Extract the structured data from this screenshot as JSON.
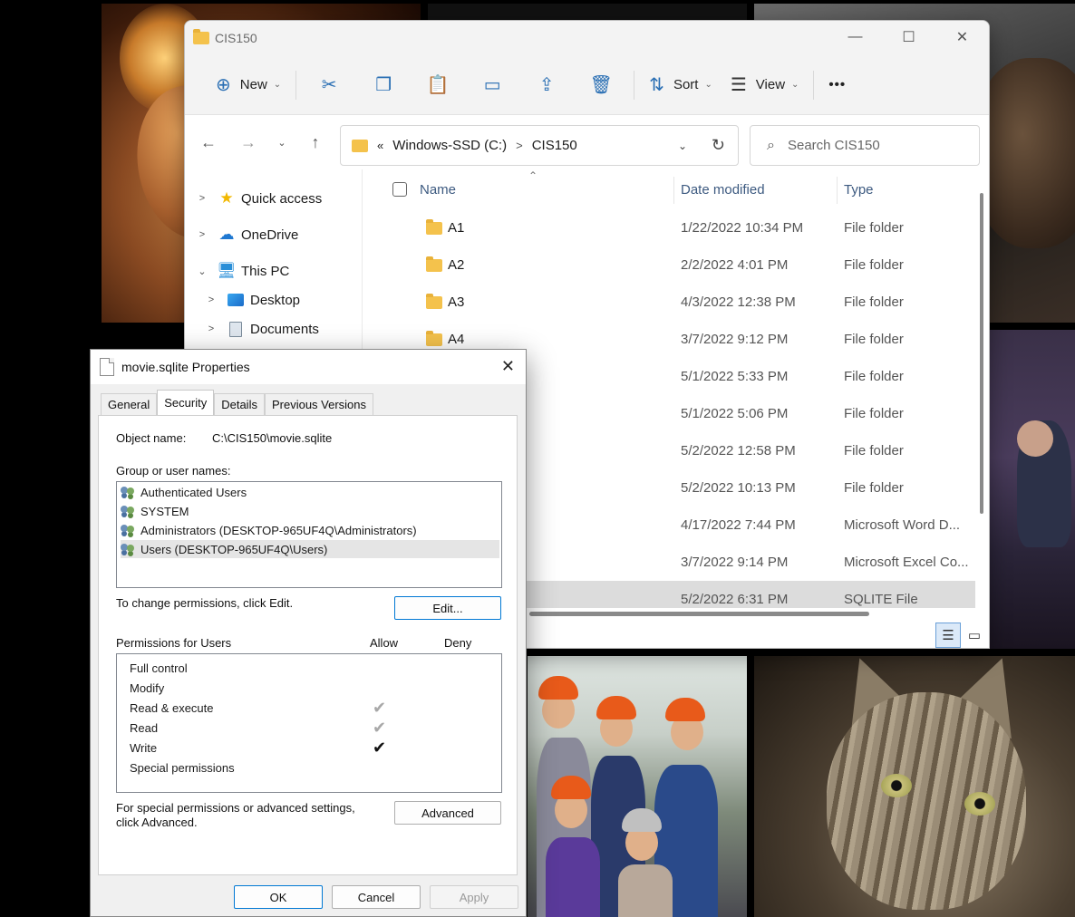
{
  "explorer": {
    "title": "CIS150",
    "caption": {
      "minimize": "—",
      "maximize": "☐",
      "close": "✕"
    },
    "toolbar": {
      "new_label": "New",
      "sort_label": "Sort",
      "view_label": "View",
      "more_label": "•••",
      "icons": [
        "cut-icon",
        "copy-icon",
        "paste-icon",
        "rename-icon",
        "share-icon",
        "delete-icon"
      ]
    },
    "address": {
      "overflow": "«",
      "crumbs": [
        "Windows-SSD (C:)",
        "CIS150"
      ],
      "search_placeholder": "Search CIS150"
    },
    "nav": [
      {
        "label": "Quick access",
        "expanded": false,
        "icon": "star-icon"
      },
      {
        "label": "OneDrive",
        "expanded": false,
        "icon": "cloud-icon"
      },
      {
        "label": "This PC",
        "expanded": true,
        "icon": "monitor-icon"
      },
      {
        "label": "Desktop",
        "expanded": false,
        "icon": "desktop-icon"
      },
      {
        "label": "Documents",
        "expanded": false,
        "icon": "documents-icon"
      }
    ],
    "columns": {
      "name": "Name",
      "date": "Date modified",
      "type": "Type"
    },
    "files": [
      {
        "name": "A1",
        "date": "1/22/2022 10:34 PM",
        "type": "File folder"
      },
      {
        "name": "A2",
        "date": "2/2/2022 4:01 PM",
        "type": "File folder"
      },
      {
        "name": "A3",
        "date": "4/3/2022 12:38 PM",
        "type": "File folder"
      },
      {
        "name": "A4",
        "date": "3/7/2022 9:12 PM",
        "type": "File folder"
      },
      {
        "name": "",
        "date": "5/1/2022 5:33 PM",
        "type": "File folder"
      },
      {
        "name": "",
        "date": "5/1/2022 5:06 PM",
        "type": "File folder"
      },
      {
        "name": "",
        "date": "5/2/2022 12:58 PM",
        "type": "File folder"
      },
      {
        "name": "",
        "date": "5/2/2022 10:13 PM",
        "type": "File folder"
      },
      {
        "name": "",
        "date": "4/17/2022 7:44 PM",
        "type": "Microsoft Word D..."
      },
      {
        "name": "",
        "date": "3/7/2022 9:14 PM",
        "type": "Microsoft Excel Co..."
      },
      {
        "name": "",
        "date": "5/2/2022 6:31 PM",
        "type": "SQLITE File"
      }
    ]
  },
  "props": {
    "title": "movie.sqlite Properties",
    "tabs": [
      "General",
      "Security",
      "Details",
      "Previous Versions"
    ],
    "active_tab": "Security",
    "object_label": "Object name:",
    "object_value": "C:\\CIS150\\movie.sqlite",
    "group_label": "Group or user names:",
    "groups": [
      "Authenticated Users",
      "SYSTEM",
      "Administrators (DESKTOP-965UF4Q\\Administrators)",
      "Users (DESKTOP-965UF4Q\\Users)"
    ],
    "change_hint": "To change permissions, click Edit.",
    "edit_label": "Edit...",
    "perm_label": "Permissions for Users",
    "allow_label": "Allow",
    "deny_label": "Deny",
    "permissions": [
      {
        "name": "Full control",
        "allow": ""
      },
      {
        "name": "Modify",
        "allow": ""
      },
      {
        "name": "Read & execute",
        "allow": "✔"
      },
      {
        "name": "Read",
        "allow": "✔"
      },
      {
        "name": "Write",
        "allow": "✔"
      },
      {
        "name": "Special permissions",
        "allow": ""
      }
    ],
    "advanced_hint_1": "For special permissions or advanced settings,",
    "advanced_hint_2": "click Advanced.",
    "advanced_label": "Advanced",
    "ok_label": "OK",
    "cancel_label": "Cancel",
    "apply_label": "Apply"
  }
}
